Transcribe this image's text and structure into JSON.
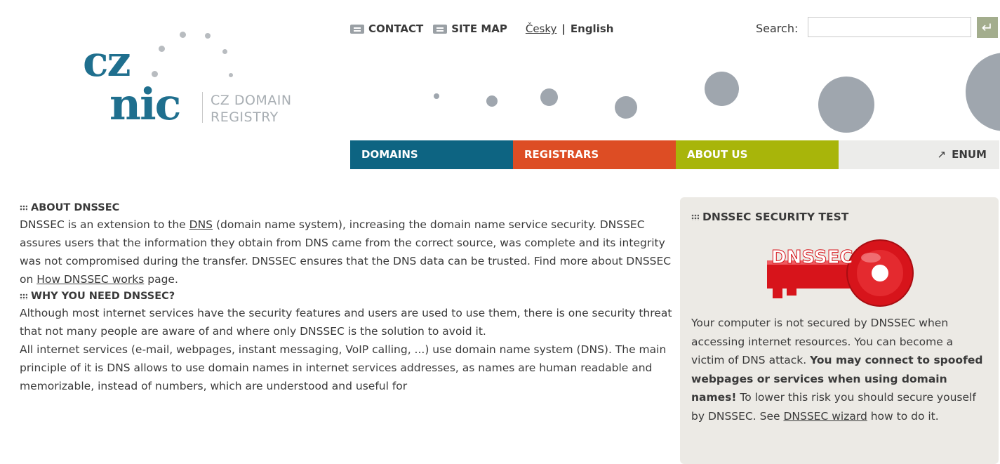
{
  "header": {
    "logo": {
      "line1": "cz",
      "line2": "nic",
      "tagline1": "CZ DOMAIN",
      "tagline2": "REGISTRY"
    },
    "top_nav": {
      "contact": "CONTACT",
      "sitemap": "SITE MAP",
      "lang_cs": "Česky",
      "separator": "|",
      "lang_en": "English"
    },
    "search": {
      "label": "Search:",
      "placeholder": "",
      "button_icon": "enter-icon"
    }
  },
  "main_nav": [
    {
      "label": "DOMAINS",
      "color": "#0d6482"
    },
    {
      "label": "REGISTRARS",
      "color": "#dd4d24"
    },
    {
      "label": "ABOUT US",
      "color": "#a8b50a"
    },
    {
      "label": "ENUM",
      "icon": "external-arrow-icon"
    }
  ],
  "content": {
    "about": {
      "heading": "ABOUT DNSSEC",
      "p_start": "DNSSEC is an extension to the ",
      "p_link": "DNS",
      "p_mid": " (domain name system), increasing the domain name service security. DNSSEC assures users that the information they obtain from DNS came from the correct source, was complete and its integrity was not compromised during the transfer. DNSSEC ensures that the DNS data can be trusted. Find more about DNSSEC on ",
      "p_link2": "How DNSSEC works",
      "p_end": " page."
    },
    "why": {
      "heading": "WHY YOU NEED DNSSEC?",
      "p1": "Although most internet services have the security features and users are used to use them, there is one security threat that not many people are aware of and where only DNSSEC is the solution to avoid it.",
      "p2": "All internet services (e-mail, webpages, instant messaging, VoIP calling, ...) use domain name system (DNS). The main principle of it is DNS allows to use domain names in internet services addresses, as names are human readable and memorizable, instead of numbers, which are understood and useful for"
    }
  },
  "sidebar": {
    "heading": "DNSSEC SECURITY TEST",
    "key_logo_text": "DNSSEC",
    "t1": "Your computer is not secured by DNSSEC when accessing internet resources. You can become a victim of DNS attack. ",
    "t_bold": "You may connect to spoofed webpages or services when using domain names!",
    "t2": " To lower this risk you should secure youself by DNSSEC. See ",
    "t_link": "DNSSEC wizard",
    "t3": " how to do it."
  },
  "colors": {
    "brand": "#1f6f8e",
    "key_red": "#d7141b",
    "sidebar_bg": "#eceae5"
  }
}
